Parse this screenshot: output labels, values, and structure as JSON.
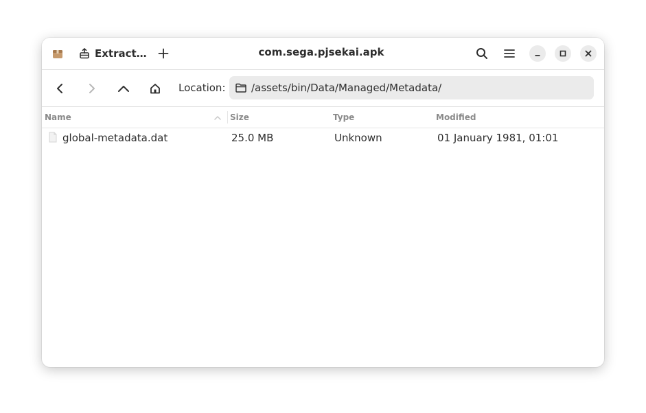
{
  "window": {
    "title": "com.sega.pjsekai.apk"
  },
  "headerbar": {
    "app_icon": "package-icon",
    "extract_label": "Extract…",
    "extract_icon": "extract-icon",
    "new_icon": "plus-icon",
    "search_icon": "search-icon",
    "menu_icon": "hamburger-menu-icon",
    "minimize_icon": "minimize-icon",
    "maximize_icon": "maximize-icon",
    "close_icon": "close-icon"
  },
  "location": {
    "label": "Location:",
    "path": "/assets/bin/Data/Managed/Metadata/",
    "folder_icon": "folder-icon"
  },
  "columns": {
    "name": "Name",
    "size": "Size",
    "type": "Type",
    "modified": "Modified",
    "sort": "ascending"
  },
  "files": [
    {
      "name": "global-metadata.dat",
      "size": "25.0 MB",
      "type": "Unknown",
      "modified": "01 January 1981, 01:01",
      "icon": "file-icon"
    }
  ],
  "colors": {
    "text": "#2e2e2e",
    "header_text": "#8a8a8a",
    "button_bg": "#ebebeb",
    "app_icon": "#c69a6d"
  }
}
